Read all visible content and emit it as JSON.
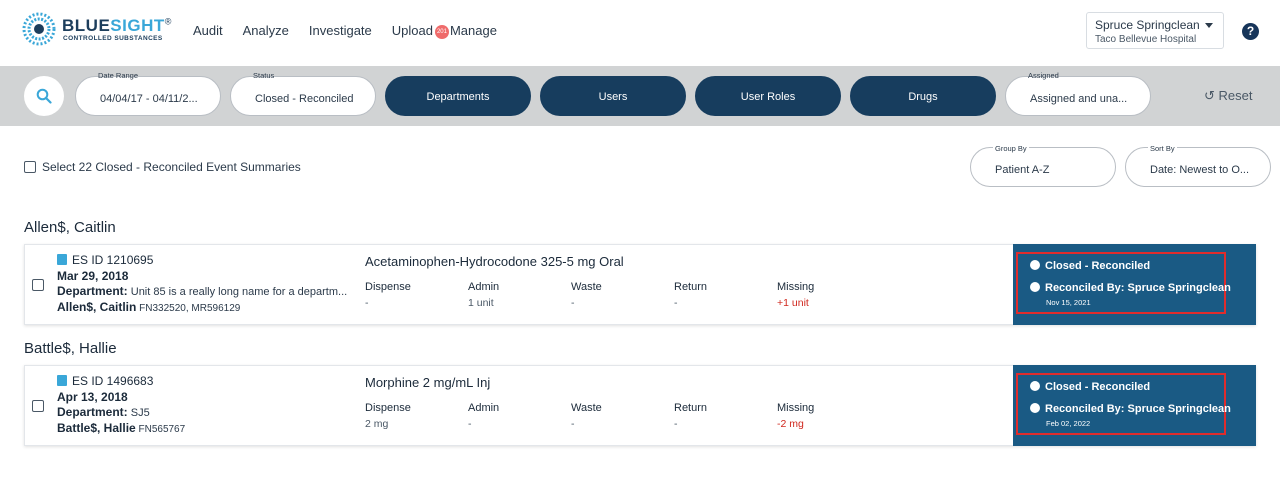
{
  "brand": {
    "name_a": "BLUE",
    "name_b": "SIGHT",
    "mark": "®",
    "subtitle": "CONTROLLED SUBSTANCES"
  },
  "nav": {
    "items": [
      "Audit",
      "Analyze",
      "Investigate",
      "Upload",
      "Manage"
    ],
    "badge": "201"
  },
  "user": {
    "name": "Spruce Springclean",
    "hospital": "Taco Bellevue Hospital"
  },
  "help": {
    "label": "?"
  },
  "filters": {
    "date_range": {
      "label": "Date Range",
      "value": "04/04/17 - 04/11/2..."
    },
    "status": {
      "label": "Status",
      "value": "Closed - Reconciled"
    },
    "departments": "Departments",
    "users": "Users",
    "user_roles": "User Roles",
    "drugs": "Drugs",
    "assigned": {
      "label": "Assigned",
      "value": "Assigned and una..."
    },
    "reset": "Reset"
  },
  "select_all": "Select 22 Closed - Reconciled Event Summaries",
  "group_by": {
    "label": "Group By",
    "value": "Patient A-Z"
  },
  "sort_by": {
    "label": "Sort By",
    "value": "Date: Newest to O..."
  },
  "columns": [
    "Dispense",
    "Admin",
    "Waste",
    "Return",
    "Missing"
  ],
  "groups": [
    {
      "name": "Allen$, Caitlin",
      "es_id": "ES ID 1210695",
      "date": "Mar 29, 2018",
      "dept_label": "Department:",
      "dept_value": "Unit 85 is a really long name for a departm...",
      "patient_name": "Allen$, Caitlin",
      "patient_ids": "FN332520, MR596129",
      "drug": "Acetaminophen-Hydrocodone 325-5 mg Oral",
      "values": [
        "-",
        "1 unit",
        "-",
        "-",
        "+1 unit"
      ],
      "status": "Closed - Reconciled",
      "reconciled_by": "Reconciled By: Spruce Springclean",
      "reconciled_date": "Nov 15, 2021"
    },
    {
      "name": "Battle$, Hallie",
      "es_id": "ES ID 1496683",
      "date": "Apr 13, 2018",
      "dept_label": "Department:",
      "dept_value": "SJ5",
      "patient_name": "Battle$, Hallie",
      "patient_ids": "FN565767",
      "drug": "Morphine 2 mg/mL Inj",
      "values": [
        "2 mg",
        "-",
        "-",
        "-",
        "-2 mg"
      ],
      "status": "Closed - Reconciled",
      "reconciled_by": "Reconciled By: Spruce Springclean",
      "reconciled_date": "Feb 02, 2022"
    }
  ]
}
